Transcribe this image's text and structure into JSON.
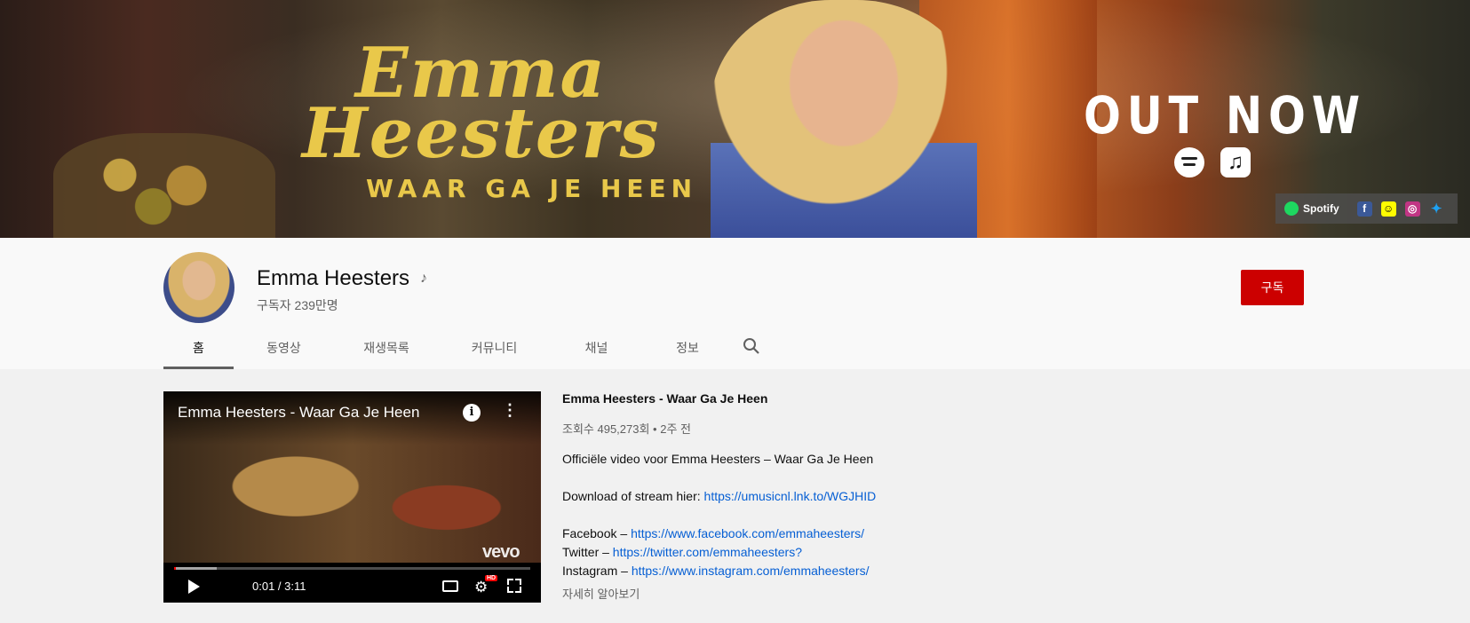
{
  "banner": {
    "logo_line1": "Emma",
    "logo_line2": "Heesters",
    "logo_sub": "WAAR GA JE HEEN",
    "promo": "OUT NOW",
    "spotify_label": "Spotify",
    "icons": [
      "spotify-icon",
      "apple-music-icon",
      "facebook-icon",
      "snapchat-icon",
      "instagram-icon",
      "twitter-icon"
    ]
  },
  "channel": {
    "name": "Emma Heesters",
    "subscribers": "구독자 239만명",
    "subscribe_label": "구독"
  },
  "tabs": [
    {
      "label": "홈",
      "active": true
    },
    {
      "label": "동영상"
    },
    {
      "label": "재생목록"
    },
    {
      "label": "커뮤니티"
    },
    {
      "label": "채널"
    },
    {
      "label": "정보"
    }
  ],
  "player": {
    "title": "Emma Heesters - Waar Ga Je Heen",
    "brand": "vevo",
    "time": "0:01 / 3:11",
    "hd_badge": "HD",
    "progress": 0.005,
    "buffered": 0.12
  },
  "video": {
    "title": "Emma Heesters - Waar Ga Je Heen",
    "meta": "조회수 495,273회 • 2주 전",
    "line1": "Officiële video voor Emma Heesters – Waar Ga Je Heen",
    "download_prefix": "Download of stream hier: ",
    "download_link": "https://umusicnl.lnk.to/WGJHID",
    "facebook_prefix": "Facebook – ",
    "facebook_link": "https://www.facebook.com/emmaheesters/",
    "twitter_prefix": "Twitter – ",
    "twitter_link": "https://twitter.com/emmaheesters?",
    "instagram_prefix": "Instagram – ",
    "instagram_link": "https://www.instagram.com/emmaheesters/",
    "more": "자세히 알아보기"
  },
  "colors": {
    "accent": "#cc0000",
    "link": "#065fd4",
    "logo_yellow": "#e9c84a"
  }
}
